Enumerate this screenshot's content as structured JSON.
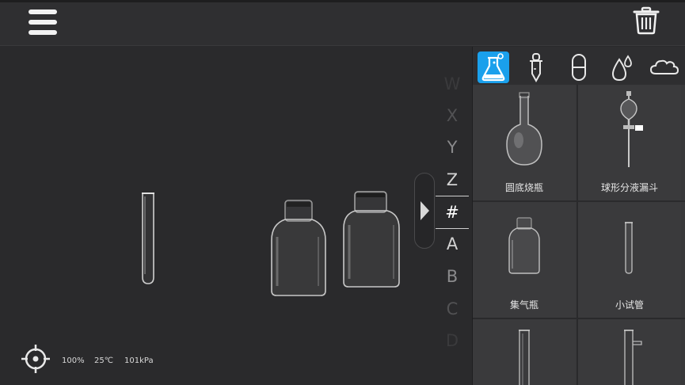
{
  "toolbar": {
    "menu_icon": "hamburger-menu-icon",
    "trash_icon": "trash-icon"
  },
  "alphabet": {
    "letters": [
      "W",
      "X",
      "Y",
      "Z",
      "#",
      "A",
      "B",
      "C",
      "D"
    ],
    "selected": "#"
  },
  "status": {
    "zoom": "100%",
    "temperature": "25℃",
    "pressure": "101kPa"
  },
  "panel": {
    "tabs": [
      {
        "icon": "flask-icon",
        "active": true
      },
      {
        "icon": "dropper-icon",
        "active": false
      },
      {
        "icon": "capsule-icon",
        "active": false
      },
      {
        "icon": "droplets-icon",
        "active": false
      },
      {
        "icon": "cloud-icon",
        "active": false
      }
    ],
    "items": [
      {
        "label": "圆底烧瓶"
      },
      {
        "label": "球形分液漏斗"
      },
      {
        "label": "集气瓶"
      },
      {
        "label": "小试管"
      },
      {
        "label": ""
      },
      {
        "label": ""
      }
    ]
  },
  "colors": {
    "accent": "#1aa0ec",
    "background": "#2a2a2c",
    "panel": "#3a3a3c"
  }
}
